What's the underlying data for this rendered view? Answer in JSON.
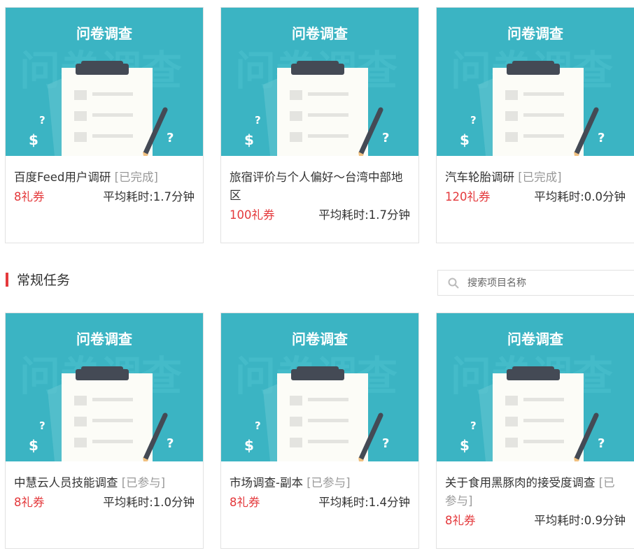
{
  "banner_text": "问卷调查",
  "top_cards": [
    {
      "title": "百度Feed用户调研",
      "status": "[已完成]",
      "reward": "8礼券",
      "time": "平均耗时:1.7分钟"
    },
    {
      "title": "旅宿评价与个人偏好～台湾中部地区",
      "status": "",
      "reward": "100礼券",
      "time": "平均耗时:1.7分钟"
    },
    {
      "title": "汽车轮胎调研",
      "status": "[已完成]",
      "reward": "120礼券",
      "time": "平均耗时:0.0分钟"
    }
  ],
  "section": {
    "title": "常规任务"
  },
  "search": {
    "placeholder": "搜索项目名称"
  },
  "bottom_cards": [
    {
      "title": "中慧云人员技能调查",
      "status": "[已参与]",
      "reward": "8礼券",
      "time": "平均耗时:1.0分钟"
    },
    {
      "title": "市场调查-副本",
      "status": "[已参与]",
      "reward": "8礼券",
      "time": "平均耗时:1.4分钟"
    },
    {
      "title": "关于食用黑豚肉的接受度调查",
      "status": "[已参与]",
      "reward": "8礼券",
      "time": "平均耗时:0.9分钟"
    }
  ],
  "colors": {
    "banner": "#3bb4c3",
    "accent": "#e4393c",
    "status": "#999999"
  }
}
